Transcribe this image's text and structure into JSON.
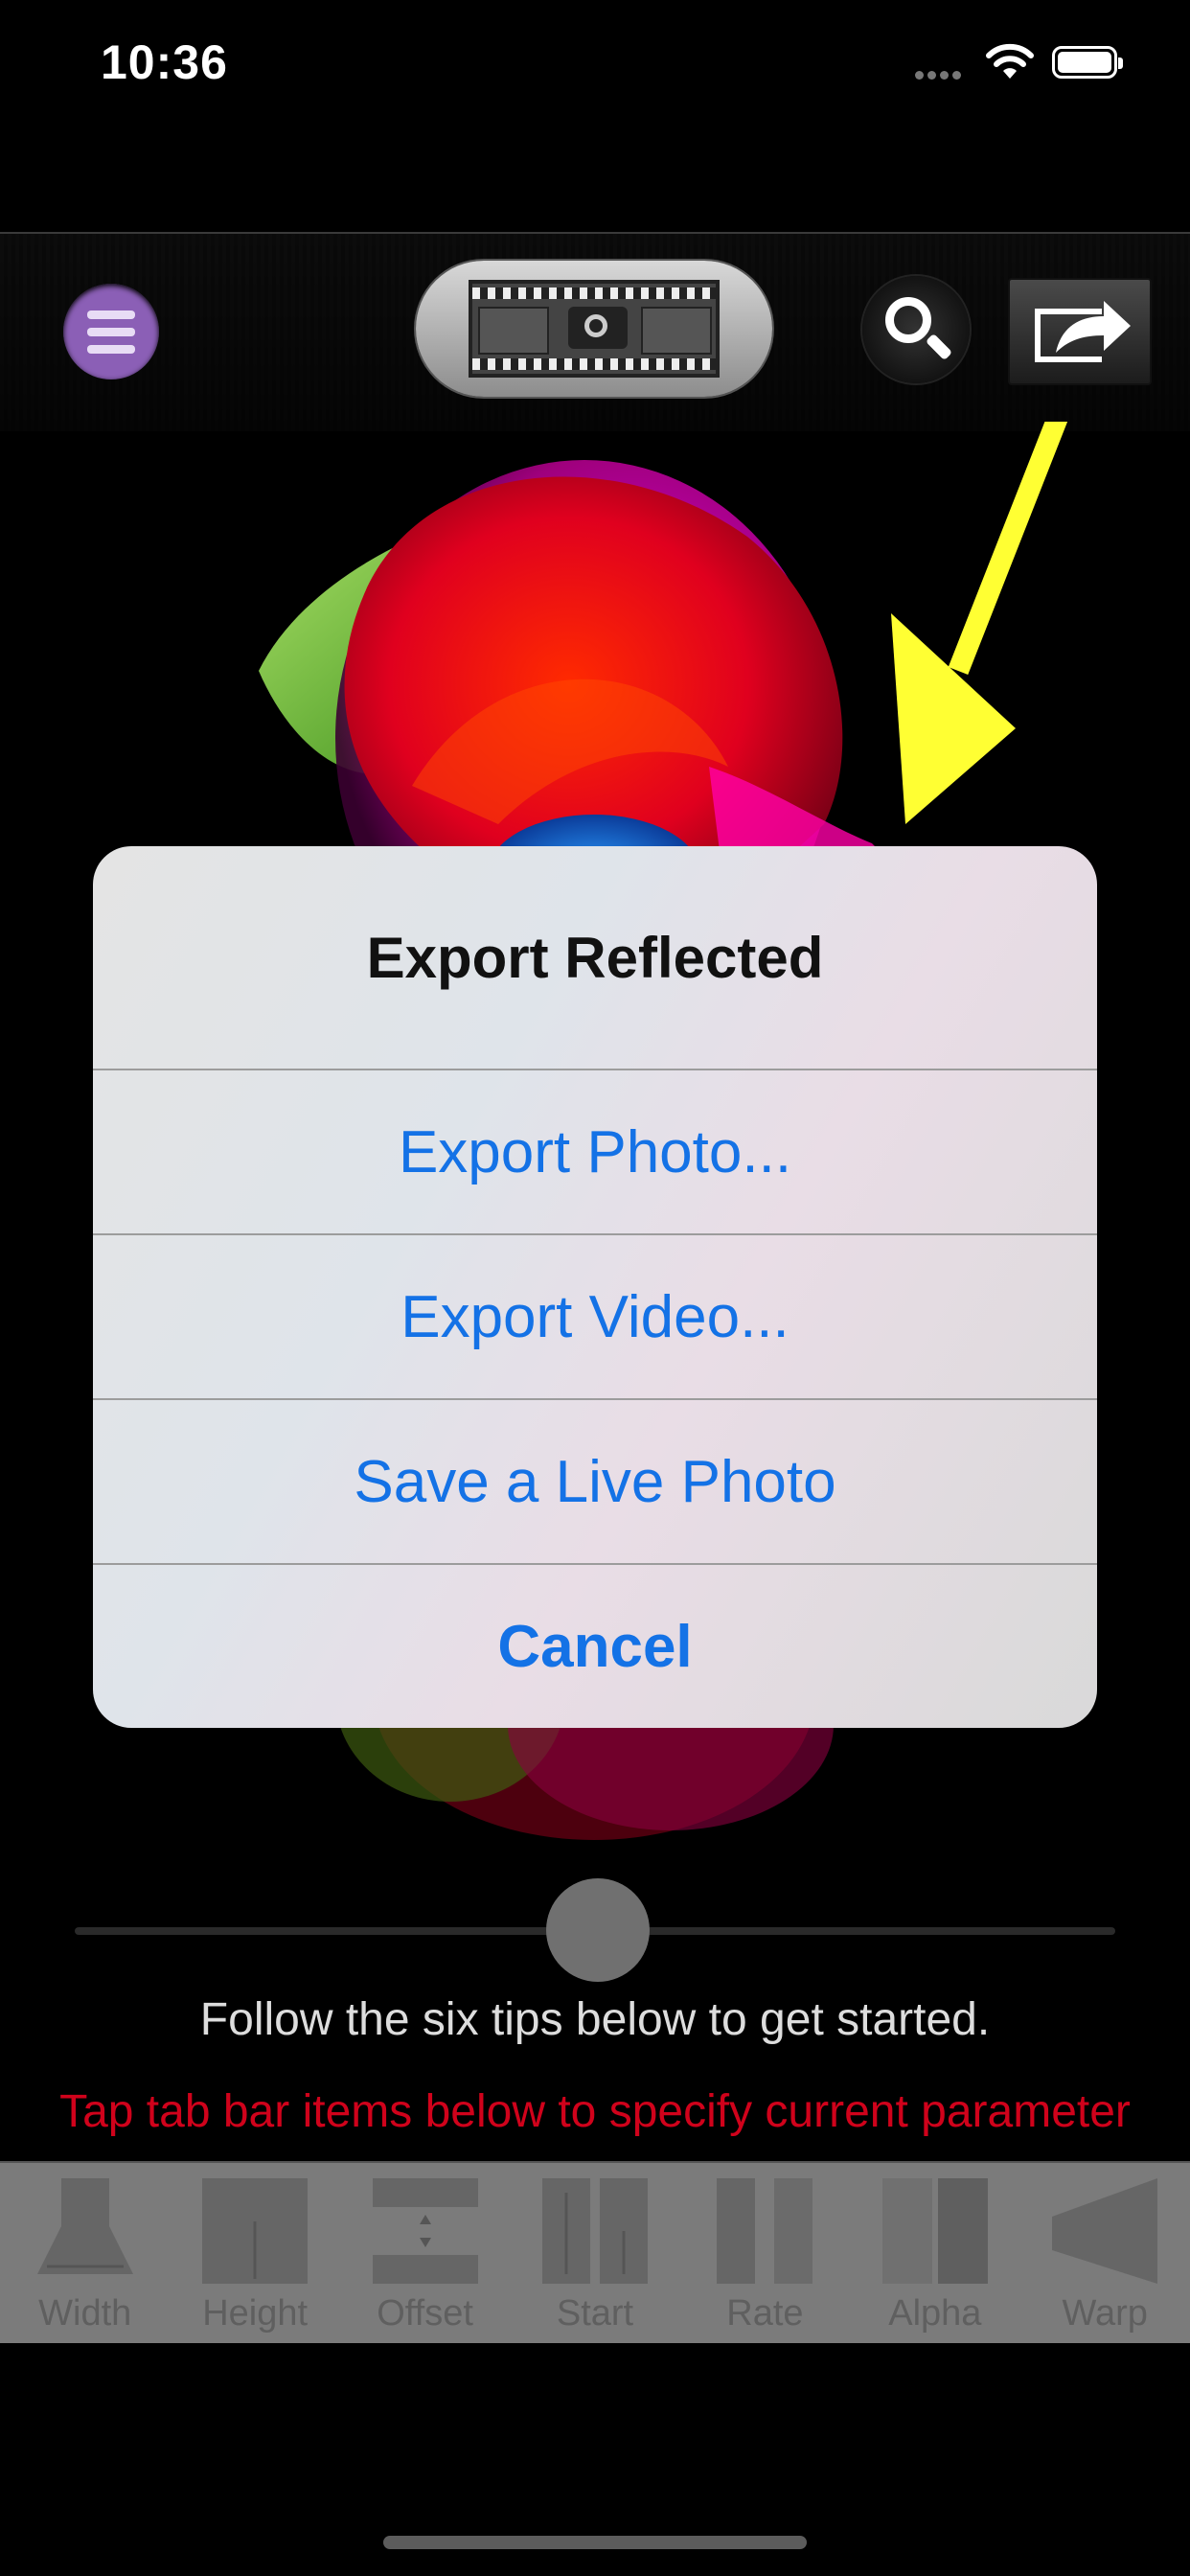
{
  "status_bar": {
    "time": "10:36"
  },
  "toolbar": {
    "menu_icon": "hamburger-icon",
    "camera_icon": "camera-film-icon",
    "search_icon": "search-icon",
    "share_icon": "share-icon"
  },
  "alert": {
    "title": "Export Reflected",
    "buttons": [
      {
        "label": "Export Photo..."
      },
      {
        "label": "Export Video..."
      },
      {
        "label": "Save a Live Photo"
      },
      {
        "label": "Cancel"
      }
    ],
    "accent": "#1472e6"
  },
  "slider": {
    "value": 0.5
  },
  "tips": {
    "main": "Follow the six tips below to get started.",
    "instruction": "Tap tab bar items below to specify current parameter",
    "instruction_color": "#d0021b"
  },
  "tabbar": {
    "items": [
      {
        "label": "Width",
        "icon": "width-icon"
      },
      {
        "label": "Height",
        "icon": "height-icon"
      },
      {
        "label": "Offset",
        "icon": "offset-icon"
      },
      {
        "label": "Start",
        "icon": "start-icon"
      },
      {
        "label": "Rate",
        "icon": "rate-icon"
      },
      {
        "label": "Alpha",
        "icon": "alpha-icon"
      },
      {
        "label": "Warp",
        "icon": "warp-icon"
      }
    ]
  },
  "annotation_arrow_color": "#ffff33"
}
